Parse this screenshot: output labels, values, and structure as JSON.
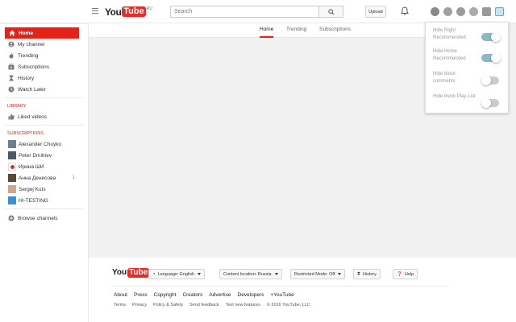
{
  "header": {
    "logo_you": "You",
    "logo_tube": "Tube",
    "logo_region": "RU",
    "search_placeholder": "Search",
    "upload_label": "Upload"
  },
  "extensions": [
    "ghostery-icon",
    "shield-icon",
    "refresh-icon",
    "puzzle-icon",
    "list-icon",
    "youtube-ext-icon"
  ],
  "sidebar": {
    "main": [
      {
        "label": "Home",
        "icon": "home-icon",
        "active": true
      },
      {
        "label": "My channel",
        "icon": "person-icon"
      },
      {
        "label": "Trending",
        "icon": "flame-icon"
      },
      {
        "label": "Subscriptions",
        "icon": "subscriptions-icon"
      },
      {
        "label": "History",
        "icon": "hourglass-icon"
      },
      {
        "label": "Watch Later",
        "icon": "clock-icon"
      }
    ],
    "library_heading": "LIBRARY",
    "library": [
      {
        "label": "Liked videos",
        "icon": "thumbs-up-icon"
      }
    ],
    "subscriptions_heading": "SUBSCRIPTIONS",
    "subscriptions": [
      {
        "label": "Alexander Chuyko",
        "count": ""
      },
      {
        "label": "Peter Dmitriev",
        "count": ""
      },
      {
        "label": "Ирина ШИ",
        "count": ""
      },
      {
        "label": "Анна Денисова",
        "count": "1"
      },
      {
        "label": "Sergej Kuts",
        "count": ""
      },
      {
        "label": "HI-TESTING",
        "count": ""
      }
    ],
    "browse_label": "Browse channels"
  },
  "tabs": [
    {
      "label": "Home",
      "active": true
    },
    {
      "label": "Trending",
      "active": false
    },
    {
      "label": "Subscriptions",
      "active": false
    }
  ],
  "popup": [
    {
      "label": "Hide Right Recommended",
      "on": true
    },
    {
      "label": "Hide Home Recommended",
      "on": true
    },
    {
      "label": "Hide block comments",
      "on": false
    },
    {
      "label": "Hide block Play-List",
      "on": false
    }
  ],
  "footer": {
    "logo_you": "You",
    "logo_tube": "Tube",
    "language": "Language: English",
    "location": "Content location: Russia",
    "restricted": "Restricted Mode: Off",
    "history": "History",
    "help": "Help",
    "links": [
      "About",
      "Press",
      "Copyright",
      "Creators",
      "Advertise",
      "Developers",
      "+YouTube"
    ],
    "links2": [
      "Terms",
      "Privacy",
      "Policy & Safety",
      "Send feedback",
      "Test new features",
      "© 2016 YouTube, LLC"
    ]
  },
  "colors": {
    "accent": "#e62117",
    "toggle_on": "#8ab9c8"
  }
}
